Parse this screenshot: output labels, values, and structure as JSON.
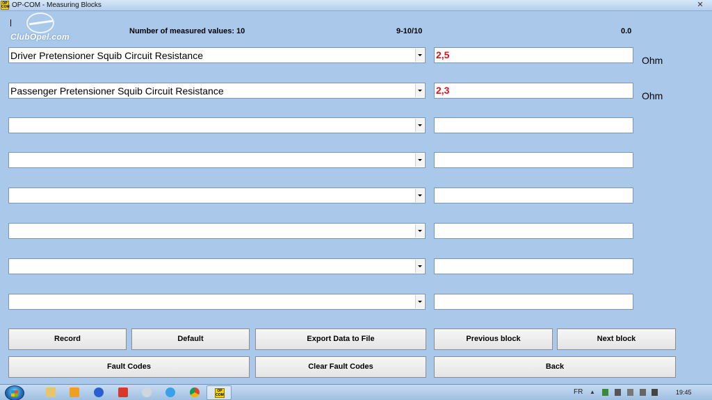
{
  "window": {
    "app_icon_text": "OP COM",
    "title": "OP-COM - Measuring Blocks",
    "close_glyph": "✕"
  },
  "logo": {
    "text": "ClubOpel.com"
  },
  "header": {
    "count_label": "Number of measured values: 10",
    "block_range": "9-10/10",
    "time_value": "0.0"
  },
  "rows": [
    {
      "label": "Driver Pretensioner Squib Circuit Resistance",
      "value": "2,5",
      "unit": "Ohm"
    },
    {
      "label": "Passenger Pretensioner Squib Circuit Resistance",
      "value": "2,3",
      "unit": "Ohm"
    },
    {
      "label": "",
      "value": "",
      "unit": ""
    },
    {
      "label": "",
      "value": "",
      "unit": ""
    },
    {
      "label": "",
      "value": "",
      "unit": ""
    },
    {
      "label": "",
      "value": "",
      "unit": ""
    },
    {
      "label": "",
      "value": "",
      "unit": ""
    },
    {
      "label": "",
      "value": "",
      "unit": ""
    }
  ],
  "buttons": {
    "record": "Record",
    "default": "Default",
    "export": "Export Data to File",
    "previous": "Previous block",
    "next": "Next block",
    "fault_codes": "Fault Codes",
    "clear_fault_codes": "Clear Fault Codes",
    "back": "Back"
  },
  "taskbar": {
    "active_app_icon_text": "OP COM",
    "language": "FR",
    "clock": "19:45"
  },
  "colors": {
    "background": "#a9c8ea",
    "value_text": "#e0101a"
  }
}
